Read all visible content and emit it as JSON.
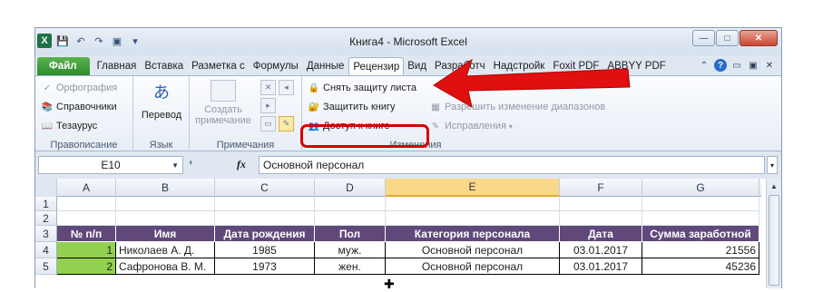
{
  "window": {
    "title": "Книга4 - Microsoft Excel",
    "win_buttons": [
      "—",
      "□",
      "✕"
    ]
  },
  "qat": {
    "icons": [
      "excel-logo",
      "save-icon",
      "undo-icon",
      "redo-icon",
      "customize-icon"
    ],
    "logo_letter": "X",
    "glyphs": [
      "💾",
      "↶",
      "↷",
      "▣",
      "▾"
    ]
  },
  "tabs": [
    {
      "label": "Файл",
      "kind": "file"
    },
    {
      "label": "Главная"
    },
    {
      "label": "Вставка"
    },
    {
      "label": "Разметка с"
    },
    {
      "label": "Формулы"
    },
    {
      "label": "Данные"
    },
    {
      "label": "Рецензир",
      "kind": "active"
    },
    {
      "label": "Вид"
    },
    {
      "label": "Разработч"
    },
    {
      "label": "Надстройк"
    },
    {
      "label": "Foxit PDF"
    },
    {
      "label": "ABBYY PDF"
    }
  ],
  "tab_right_glyphs": [
    "⌃",
    "?",
    "▭",
    "▣",
    "✕"
  ],
  "ribbon": {
    "spelling": {
      "spell": "Орфография",
      "research": "Справочники",
      "thesaurus": "Тезаурус",
      "group": "Правописание"
    },
    "language": {
      "translate": "Перевод",
      "group": "Язык"
    },
    "comments": {
      "new_comment": "Создать примечание",
      "group": "Примечания"
    },
    "changes": {
      "unprotect_sheet": "Снять защиту листа",
      "protect_workbook": "Защитить книгу",
      "share_workbook": "Доступ к книге",
      "allow_ranges": "Разрешить изменение диапазонов",
      "track_changes": "Исправления",
      "group": "Изменения"
    }
  },
  "formula_bar": {
    "name_box": "E10",
    "fx": "fx",
    "content": "Основной персонал"
  },
  "columns": [
    "A",
    "B",
    "C",
    "D",
    "E",
    "F",
    "G"
  ],
  "rows": {
    "r1": "1",
    "r2": "2",
    "r3": "3",
    "r4": "4",
    "r5": "5"
  },
  "table": {
    "headers": [
      "№ п/п",
      "Имя",
      "Дата рождения",
      "Пол",
      "Категория персонала",
      "Дата",
      "Сумма заработной"
    ],
    "data": [
      [
        "1",
        "Николаев А. Д.",
        "1985",
        "муж.",
        "Основной персонал",
        "03.01.2017",
        "21556"
      ],
      [
        "2",
        "Сафронова В. М.",
        "1973",
        "жен.",
        "Основной персонал",
        "03.01.2017",
        "45236"
      ]
    ]
  },
  "colors": {
    "header_bg": "#60497a",
    "id_cell_bg": "#92d050",
    "highlight": "#d40000",
    "file_tab": "#2e8b2e"
  }
}
